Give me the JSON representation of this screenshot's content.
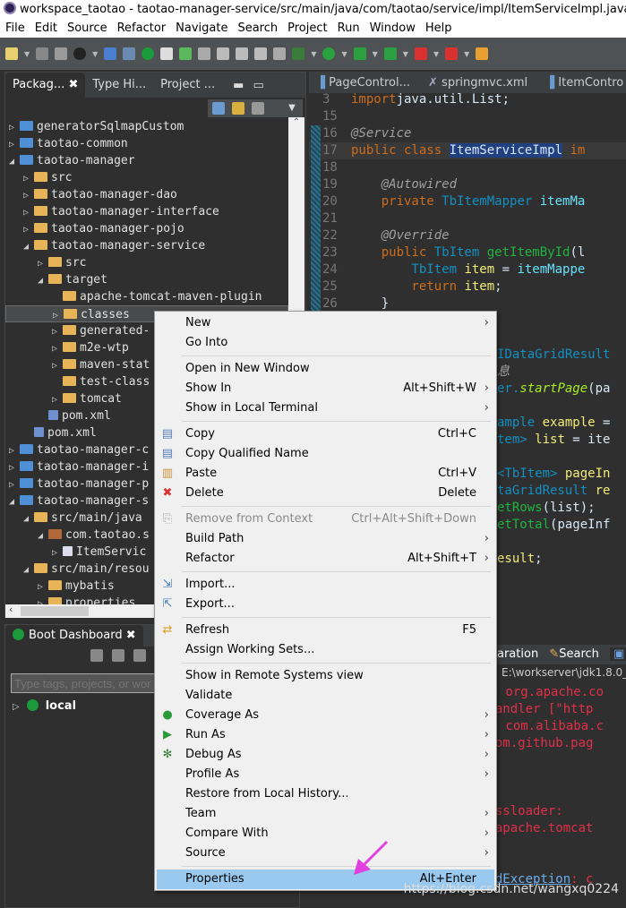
{
  "window": {
    "title": "workspace_taotao - taotao-manager-service/src/main/java/com/taotao/service/impl/ItemServiceImpl.java - Eclipse IDE"
  },
  "menubar": [
    "File",
    "Edit",
    "Source",
    "Refactor",
    "Navigate",
    "Search",
    "Project",
    "Run",
    "Window",
    "Help"
  ],
  "left_tabs": [
    {
      "label": "Packag...",
      "active": true,
      "close": "✖"
    },
    {
      "label": "Type Hi..."
    },
    {
      "label": "Project ..."
    }
  ],
  "tree": [
    {
      "label": "generatorSqlmapCustom",
      "level": 0,
      "arrow": "▷",
      "icon": "proj"
    },
    {
      "label": "taotao-common",
      "level": 0,
      "arrow": "▷",
      "icon": "proj"
    },
    {
      "label": "taotao-manager",
      "level": 0,
      "arrow": "◢",
      "icon": "proj"
    },
    {
      "label": "src",
      "level": 1,
      "arrow": "▷",
      "icon": "folder"
    },
    {
      "label": "taotao-manager-dao",
      "level": 1,
      "arrow": "▷",
      "icon": "folder"
    },
    {
      "label": "taotao-manager-interface",
      "level": 1,
      "arrow": "▷",
      "icon": "folder"
    },
    {
      "label": "taotao-manager-pojo",
      "level": 1,
      "arrow": "▷",
      "icon": "folder"
    },
    {
      "label": "taotao-manager-service",
      "level": 1,
      "arrow": "◢",
      "icon": "folder"
    },
    {
      "label": "src",
      "level": 2,
      "arrow": "▷",
      "icon": "folder"
    },
    {
      "label": "target",
      "level": 2,
      "arrow": "◢",
      "icon": "folder"
    },
    {
      "label": "apache-tomcat-maven-plugin",
      "level": 3,
      "arrow": "",
      "icon": "folder"
    },
    {
      "label": "classes",
      "level": 3,
      "arrow": "▷",
      "icon": "folder",
      "selected": true
    },
    {
      "label": "generated-",
      "level": 3,
      "arrow": "▷",
      "icon": "folder"
    },
    {
      "label": "m2e-wtp",
      "level": 3,
      "arrow": "▷",
      "icon": "folder"
    },
    {
      "label": "maven-stat",
      "level": 3,
      "arrow": "▷",
      "icon": "folder"
    },
    {
      "label": "test-class",
      "level": 3,
      "arrow": "",
      "icon": "folder"
    },
    {
      "label": "tomcat",
      "level": 3,
      "arrow": "▷",
      "icon": "folder"
    },
    {
      "label": "pom.xml",
      "level": 2,
      "arrow": "",
      "icon": "xml"
    },
    {
      "label": "pom.xml",
      "level": 1,
      "arrow": "",
      "icon": "xml"
    },
    {
      "label": "taotao-manager-c",
      "level": 0,
      "arrow": "▷",
      "icon": "proj"
    },
    {
      "label": "taotao-manager-i",
      "level": 0,
      "arrow": "▷",
      "icon": "proj"
    },
    {
      "label": "taotao-manager-p",
      "level": 0,
      "arrow": "▷",
      "icon": "proj"
    },
    {
      "label": "taotao-manager-s",
      "level": 0,
      "arrow": "◢",
      "icon": "proj"
    },
    {
      "label": "src/main/java",
      "level": 1,
      "arrow": "◢",
      "icon": "folder"
    },
    {
      "label": "com.taotao.s",
      "level": 2,
      "arrow": "◢",
      "icon": "pkg"
    },
    {
      "label": "ItemServic",
      "level": 3,
      "arrow": "▷",
      "icon": "jfile"
    },
    {
      "label": "src/main/resou",
      "level": 1,
      "arrow": "◢",
      "icon": "folder"
    },
    {
      "label": "mybatis",
      "level": 2,
      "arrow": "▷",
      "icon": "folder"
    },
    {
      "label": "properties",
      "level": 2,
      "arrow": "▷",
      "icon": "folder"
    }
  ],
  "editor_tabs": [
    "PageControl...",
    "springmvc.xml",
    "ItemContro"
  ],
  "code": [
    {
      "n": "3",
      "segs": [
        [
          "kw",
          "import"
        ],
        [
          "",
          "java.util.List;"
        ]
      ]
    },
    {
      "n": "15",
      "segs": []
    },
    {
      "n": "16",
      "segs": [
        [
          "an",
          "@Service"
        ]
      ]
    },
    {
      "n": "17",
      "segs": [
        [
          "kw",
          "public class "
        ],
        [
          "hl",
          "ItemServiceImpl"
        ],
        [
          "kw",
          " im"
        ]
      ]
    },
    {
      "n": "18",
      "segs": []
    },
    {
      "n": "19",
      "segs": [
        [
          "an",
          "    @Autowired"
        ]
      ]
    },
    {
      "n": "20",
      "segs": [
        [
          "kw",
          "    private "
        ],
        [
          "ty",
          "TbItemMapper "
        ],
        [
          "fd",
          "itemMa"
        ]
      ]
    },
    {
      "n": "21",
      "segs": []
    },
    {
      "n": "22",
      "segs": [
        [
          "an",
          "    @Override"
        ]
      ]
    },
    {
      "n": "23",
      "segs": [
        [
          "kw",
          "    public "
        ],
        [
          "ty",
          "TbItem "
        ],
        [
          "me",
          "getItemById"
        ],
        [
          "",
          "(l"
        ]
      ]
    },
    {
      "n": "24",
      "segs": [
        [
          "ty",
          "        TbItem "
        ],
        [
          "lv",
          "item"
        ],
        [
          "",
          " = "
        ],
        [
          "fd",
          "itemMappe"
        ]
      ]
    },
    {
      "n": "25",
      "segs": [
        [
          "kw",
          "        return "
        ],
        [
          "lv",
          "item"
        ],
        [
          "",
          ";"
        ]
      ]
    },
    {
      "n": "26",
      "segs": [
        [
          "",
          "    }"
        ]
      ]
    }
  ],
  "code_fragments": [
    {
      "segs": [
        [
          "ty",
          "IDataGridResult"
        ]
      ]
    },
    {
      "segs": [
        [
          "an",
          "息"
        ]
      ]
    },
    {
      "segs": [
        [
          "ty",
          "er."
        ],
        [
          "ita",
          "startPage"
        ],
        [
          "",
          "(pa"
        ]
      ]
    },
    {
      "segs": []
    },
    {
      "segs": [
        [
          "ty",
          "ample "
        ],
        [
          "lv",
          "example"
        ],
        [
          "",
          " ="
        ]
      ]
    },
    {
      "segs": [
        [
          "ty",
          "tem> "
        ],
        [
          "lv",
          "list"
        ],
        [
          "",
          " = ite"
        ]
      ]
    },
    {
      "segs": []
    },
    {
      "segs": [
        [
          "ty",
          "<TbItem> "
        ],
        [
          "lv",
          "pageIn"
        ]
      ]
    },
    {
      "segs": [
        [
          "ty",
          "taGridResult "
        ],
        [
          "lv",
          "re"
        ]
      ]
    },
    {
      "segs": [
        [
          "me",
          "etRows"
        ],
        [
          "",
          "(list);"
        ]
      ]
    },
    {
      "segs": [
        [
          "me",
          "etTotal"
        ],
        [
          "",
          "(pageInf"
        ]
      ]
    },
    {
      "segs": []
    },
    {
      "segs": [
        [
          "lv",
          "esult"
        ],
        [
          "",
          ";"
        ]
      ]
    }
  ],
  "boot": {
    "title": "Boot Dashboard",
    "search_placeholder": "Type tags, projects, or wor",
    "local": "local"
  },
  "console": {
    "tabs": [
      "aration",
      "Search",
      "C"
    ],
    "path": "E:\\workserver\\jdk1.8.0_1",
    "lines": [
      "午 org.apache.co",
      "lHandler [\"http",
      "午 com.alibaba.c",
      "'com.github.pag",
      "",
      "",
      "",
      "lassloader:",
      "g.apache.tomcat",
      "",
      ""
    ],
    "exception_prefix": "undException",
    "exception_rest": ": c"
  },
  "context_menu": [
    {
      "label": "New",
      "sub": true
    },
    {
      "label": "Go Into"
    },
    {
      "sep": true
    },
    {
      "label": "Open in New Window"
    },
    {
      "label": "Show In",
      "shortcut": "Alt+Shift+W",
      "sub": true
    },
    {
      "label": "Show in Local Terminal",
      "sub": true
    },
    {
      "sep": true
    },
    {
      "label": "Copy",
      "shortcut": "Ctrl+C",
      "icon": "copy-icon",
      "glyph": "▤",
      "color": "#5a7fb8"
    },
    {
      "label": "Copy Qualified Name",
      "icon": "copy-qualified-icon",
      "glyph": "▤",
      "color": "#5a7fb8"
    },
    {
      "label": "Paste",
      "shortcut": "Ctrl+V",
      "icon": "paste-icon",
      "glyph": "▥",
      "color": "#c8923a"
    },
    {
      "label": "Delete",
      "shortcut": "Delete",
      "icon": "delete-icon",
      "glyph": "✖",
      "color": "#d93030"
    },
    {
      "sep": true
    },
    {
      "label": "Remove from Context",
      "shortcut": "Ctrl+Alt+Shift+Down",
      "disabled": true,
      "icon": "remove-context-icon",
      "glyph": "⎘",
      "color": "#aaa"
    },
    {
      "label": "Build Path",
      "sub": true
    },
    {
      "label": "Refactor",
      "shortcut": "Alt+Shift+T",
      "sub": true
    },
    {
      "sep": true
    },
    {
      "label": "Import...",
      "icon": "import-icon",
      "glyph": "⇲",
      "color": "#4a7fb8"
    },
    {
      "label": "Export...",
      "icon": "export-icon",
      "glyph": "⇱",
      "color": "#4a7fb8"
    },
    {
      "sep": true
    },
    {
      "label": "Refresh",
      "shortcut": "F5",
      "icon": "refresh-icon",
      "glyph": "⇄",
      "color": "#d9a020"
    },
    {
      "label": "Assign Working Sets..."
    },
    {
      "sep": true
    },
    {
      "label": "Show in Remote Systems view"
    },
    {
      "label": "Validate"
    },
    {
      "label": "Coverage As",
      "sub": true,
      "icon": "coverage-icon",
      "glyph": "●",
      "color": "#2a9a3a"
    },
    {
      "label": "Run As",
      "sub": true,
      "icon": "run-icon",
      "glyph": "▶",
      "color": "#2a9a3a"
    },
    {
      "label": "Debug As",
      "sub": true,
      "icon": "debug-icon",
      "glyph": "✻",
      "color": "#3a7a3a"
    },
    {
      "label": "Profile As",
      "sub": true
    },
    {
      "label": "Restore from Local History..."
    },
    {
      "label": "Team",
      "sub": true
    },
    {
      "label": "Compare With",
      "sub": true
    },
    {
      "label": "Source",
      "sub": true
    },
    {
      "sep": true
    },
    {
      "label": "Properties",
      "shortcut": "Alt+Enter",
      "highlighted": true
    }
  ],
  "watermark": "https://blog.csdn.net/wangxq0224",
  "colors": {
    "annotation_arrow": "#e040e0",
    "menu_highlight": "#99c9ef"
  }
}
